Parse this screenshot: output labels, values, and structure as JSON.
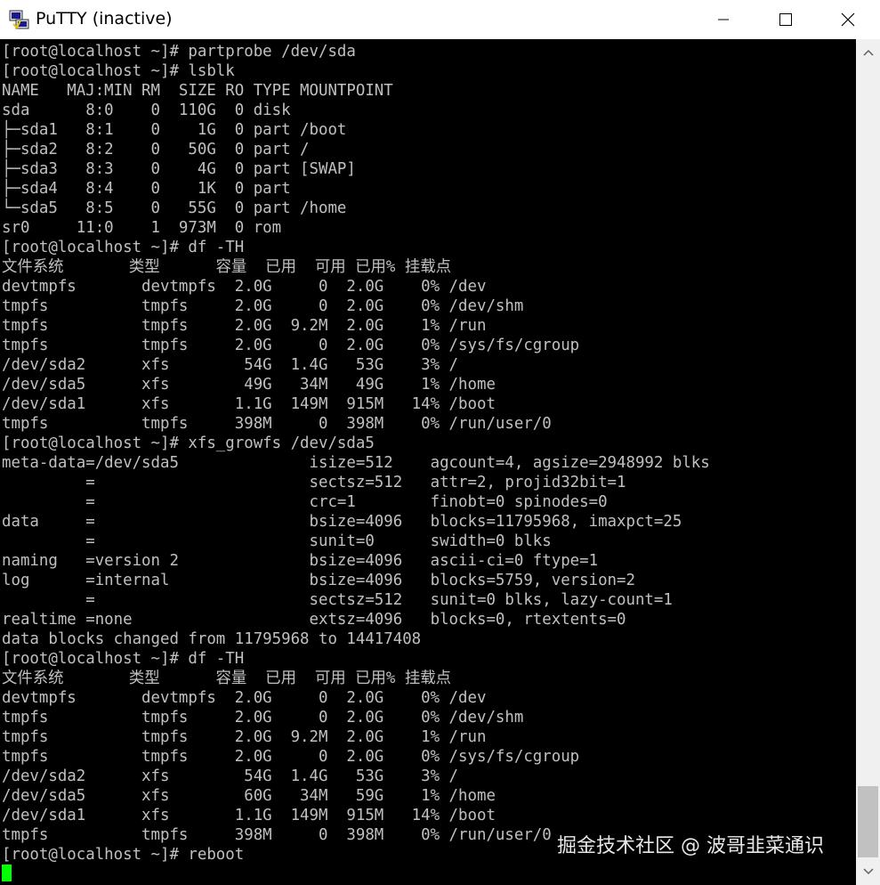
{
  "window": {
    "title": "PuTTY (inactive)"
  },
  "terminal": {
    "lines": [
      "[root@localhost ~]# partprobe /dev/sda",
      "[root@localhost ~]# lsblk",
      "NAME   MAJ:MIN RM  SIZE RO TYPE MOUNTPOINT",
      "sda      8:0    0  110G  0 disk",
      "├─sda1   8:1    0    1G  0 part /boot",
      "├─sda2   8:2    0   50G  0 part /",
      "├─sda3   8:3    0    4G  0 part [SWAP]",
      "├─sda4   8:4    0    1K  0 part",
      "└─sda5   8:5    0   55G  0 part /home",
      "sr0     11:0    1  973M  0 rom",
      "[root@localhost ~]# df -TH",
      "文件系统       类型      容量  已用  可用 已用% 挂载点",
      "devtmpfs       devtmpfs  2.0G     0  2.0G    0% /dev",
      "tmpfs          tmpfs     2.0G     0  2.0G    0% /dev/shm",
      "tmpfs          tmpfs     2.0G  9.2M  2.0G    1% /run",
      "tmpfs          tmpfs     2.0G     0  2.0G    0% /sys/fs/cgroup",
      "/dev/sda2      xfs        54G  1.4G   53G    3% /",
      "/dev/sda5      xfs        49G   34M   49G    1% /home",
      "/dev/sda1      xfs       1.1G  149M  915M   14% /boot",
      "tmpfs          tmpfs     398M     0  398M    0% /run/user/0",
      "[root@localhost ~]# xfs_growfs /dev/sda5",
      "meta-data=/dev/sda5              isize=512    agcount=4, agsize=2948992 blks",
      "         =                       sectsz=512   attr=2, projid32bit=1",
      "         =                       crc=1        finobt=0 spinodes=0",
      "data     =                       bsize=4096   blocks=11795968, imaxpct=25",
      "         =                       sunit=0      swidth=0 blks",
      "naming   =version 2              bsize=4096   ascii-ci=0 ftype=1",
      "log      =internal               bsize=4096   blocks=5759, version=2",
      "         =                       sectsz=512   sunit=0 blks, lazy-count=1",
      "realtime =none                   extsz=4096   blocks=0, rtextents=0",
      "data blocks changed from 11795968 to 14417408",
      "[root@localhost ~]# df -TH",
      "文件系统       类型      容量  已用  可用 已用% 挂载点",
      "devtmpfs       devtmpfs  2.0G     0  2.0G    0% /dev",
      "tmpfs          tmpfs     2.0G     0  2.0G    0% /dev/shm",
      "tmpfs          tmpfs     2.0G  9.2M  2.0G    1% /run",
      "tmpfs          tmpfs     2.0G     0  2.0G    0% /sys/fs/cgroup",
      "/dev/sda2      xfs        54G  1.4G   53G    3% /",
      "/dev/sda5      xfs        60G   34M   59G    1% /home",
      "/dev/sda1      xfs       1.1G  149M  915M   14% /boot",
      "tmpfs          tmpfs     398M     0  398M    0% /run/user/0",
      "[root@localhost ~]# reboot"
    ],
    "foreground": "#c0c0c0",
    "background": "#000000",
    "cursor_color": "#00ff00"
  },
  "watermark": {
    "text": "掘金技术社区 @ 波哥韭菜通识"
  },
  "icons": {
    "app": "putty-icon",
    "minimize": "minimize-icon",
    "maximize": "maximize-icon",
    "close": "close-icon"
  }
}
